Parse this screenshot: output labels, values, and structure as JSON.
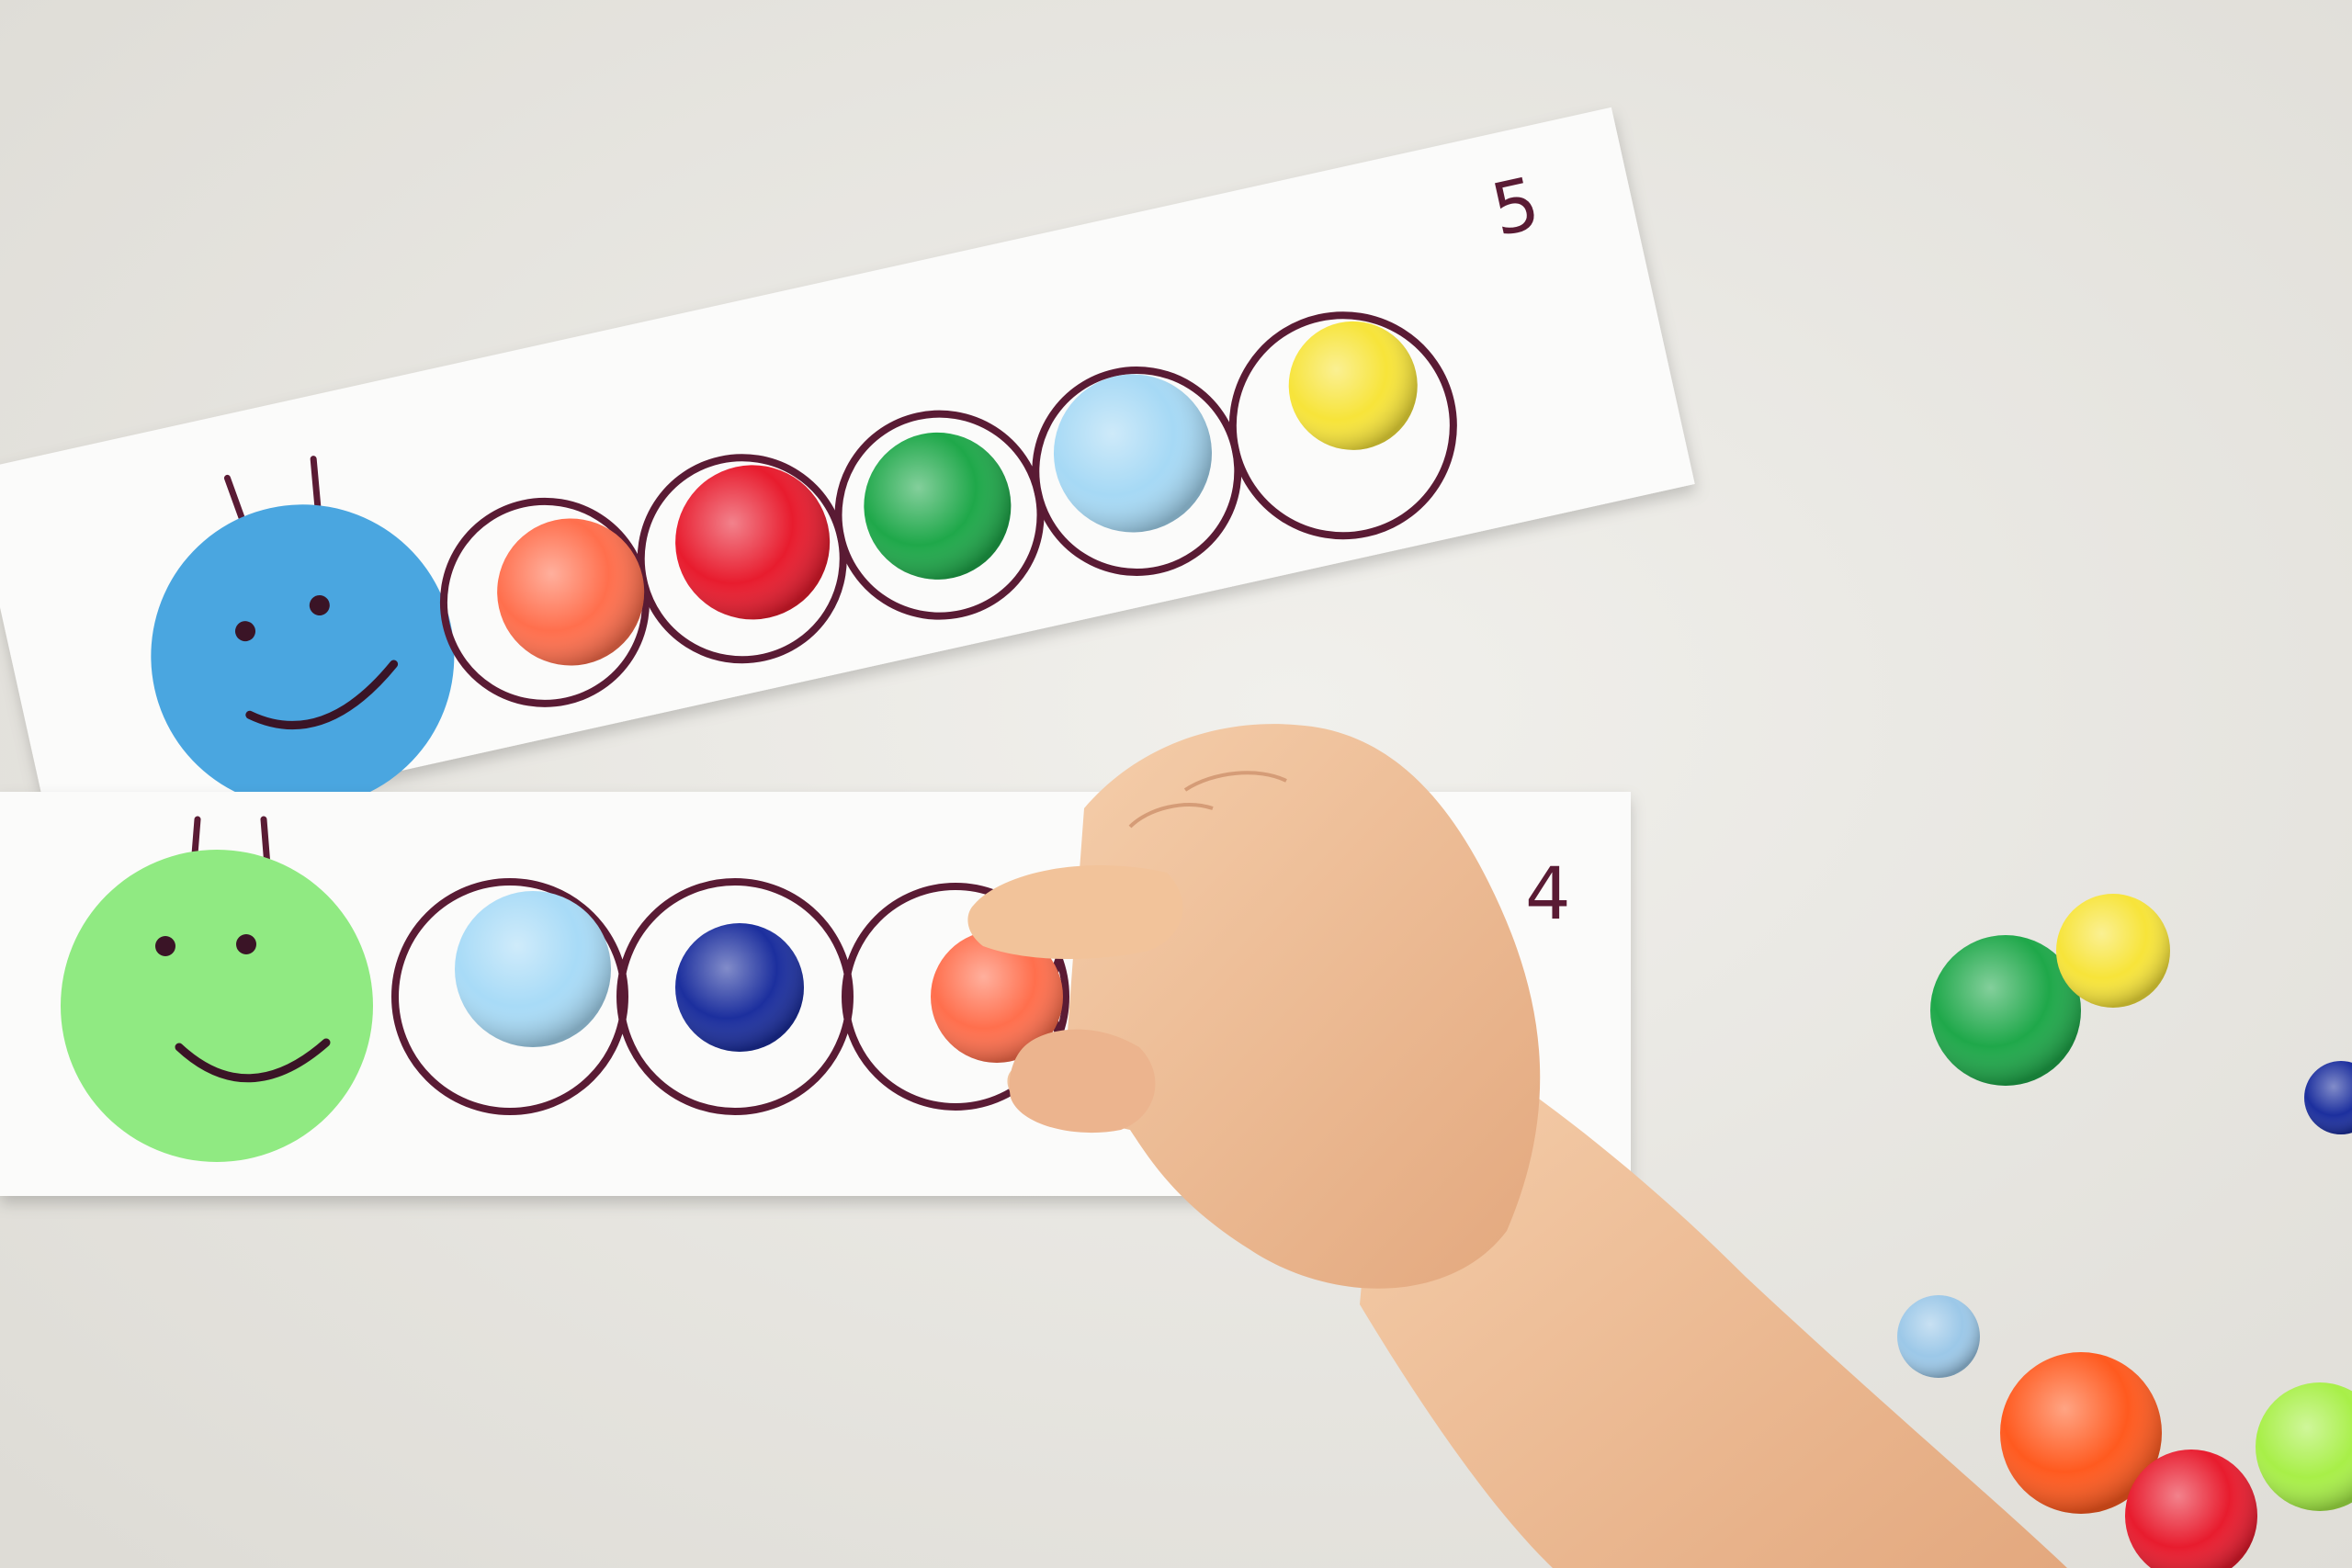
{
  "strips": [
    {
      "number": "5",
      "head_color": "#4aa6e0",
      "pompoms": [
        {
          "color": "#ff6f4d"
        },
        {
          "color": "#e81c2e"
        },
        {
          "color": "#1fa84a"
        },
        {
          "color": "#a6d9f5"
        },
        {
          "color": "#f7e43a"
        }
      ]
    },
    {
      "number": "4",
      "head_color": "#90ea82",
      "pompoms": [
        {
          "color": "#a8dbf7"
        },
        {
          "color": "#1c2f9e"
        },
        {
          "color": "#ff6f4d"
        }
      ]
    }
  ],
  "colors": {
    "table": "#e9e8e3",
    "paper": "#fbfbfa",
    "ink": "#5a1b34",
    "skin": "#f2c39a"
  },
  "loose_pompoms": [
    {
      "color": "#1fa84a"
    },
    {
      "color": "#f7e43a"
    },
    {
      "color": "#1c2f9e"
    },
    {
      "color": "#ff5a1f"
    },
    {
      "color": "#e81c2e"
    },
    {
      "color": "#a8ef48"
    },
    {
      "color": "#9cc8e8"
    }
  ]
}
